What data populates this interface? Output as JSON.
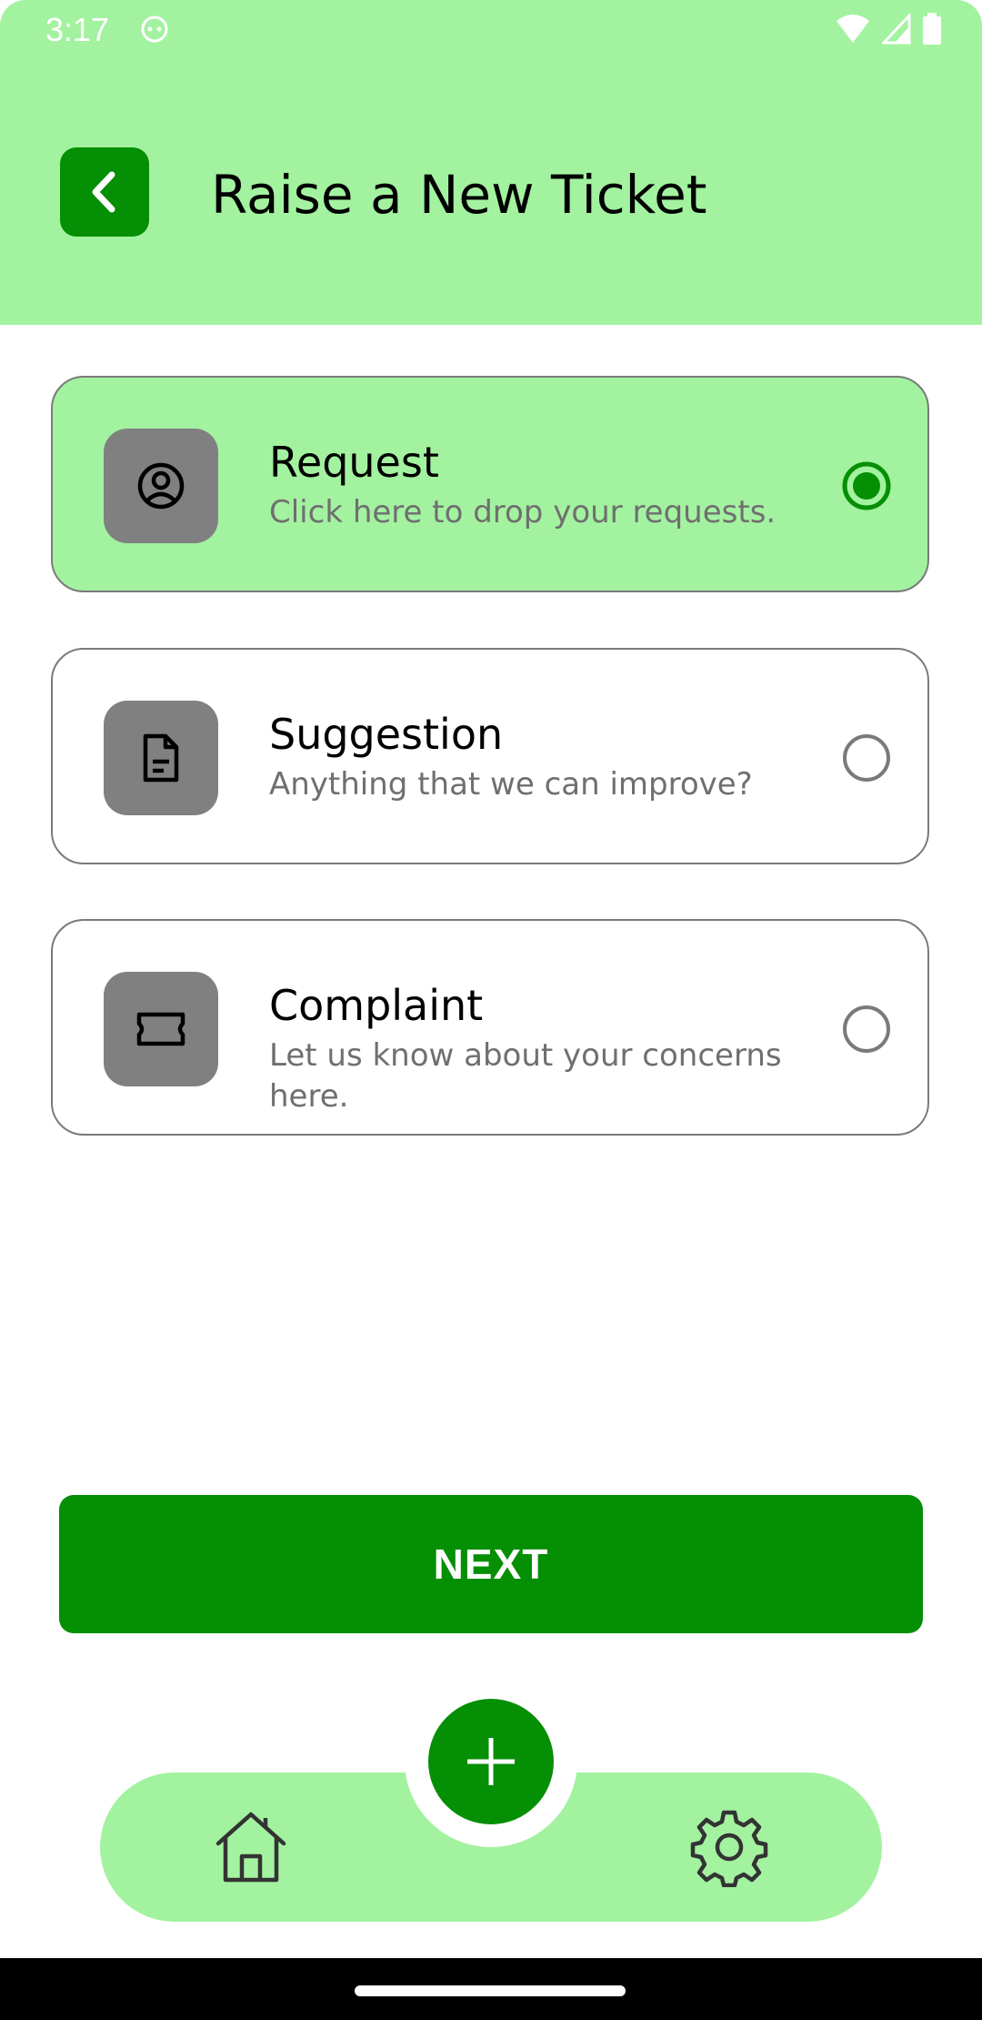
{
  "status_bar": {
    "time": "3:17",
    "icons": [
      "smiley-icon",
      "wifi-icon",
      "signal-icon",
      "battery-icon"
    ]
  },
  "header": {
    "title": "Raise a New Ticket",
    "back_icon": "chevron-left-icon"
  },
  "options": [
    {
      "title": "Request",
      "subtitle": "Click here to drop your requests.",
      "icon": "user-circle-icon",
      "selected": true
    },
    {
      "title": "Suggestion",
      "subtitle": "Anything that we can improve?",
      "icon": "document-icon",
      "selected": false
    },
    {
      "title": "Complaint",
      "subtitle": "Let us know about your concerns here.",
      "icon": "ticket-icon",
      "selected": false
    }
  ],
  "next_label": "NEXT",
  "bottom_nav": {
    "items": [
      "home-icon",
      "plus-icon",
      "gear-icon"
    ]
  },
  "colors": {
    "accent": "#058f05",
    "light_accent": "#a3f2a0",
    "icon_bg": "#808080"
  }
}
